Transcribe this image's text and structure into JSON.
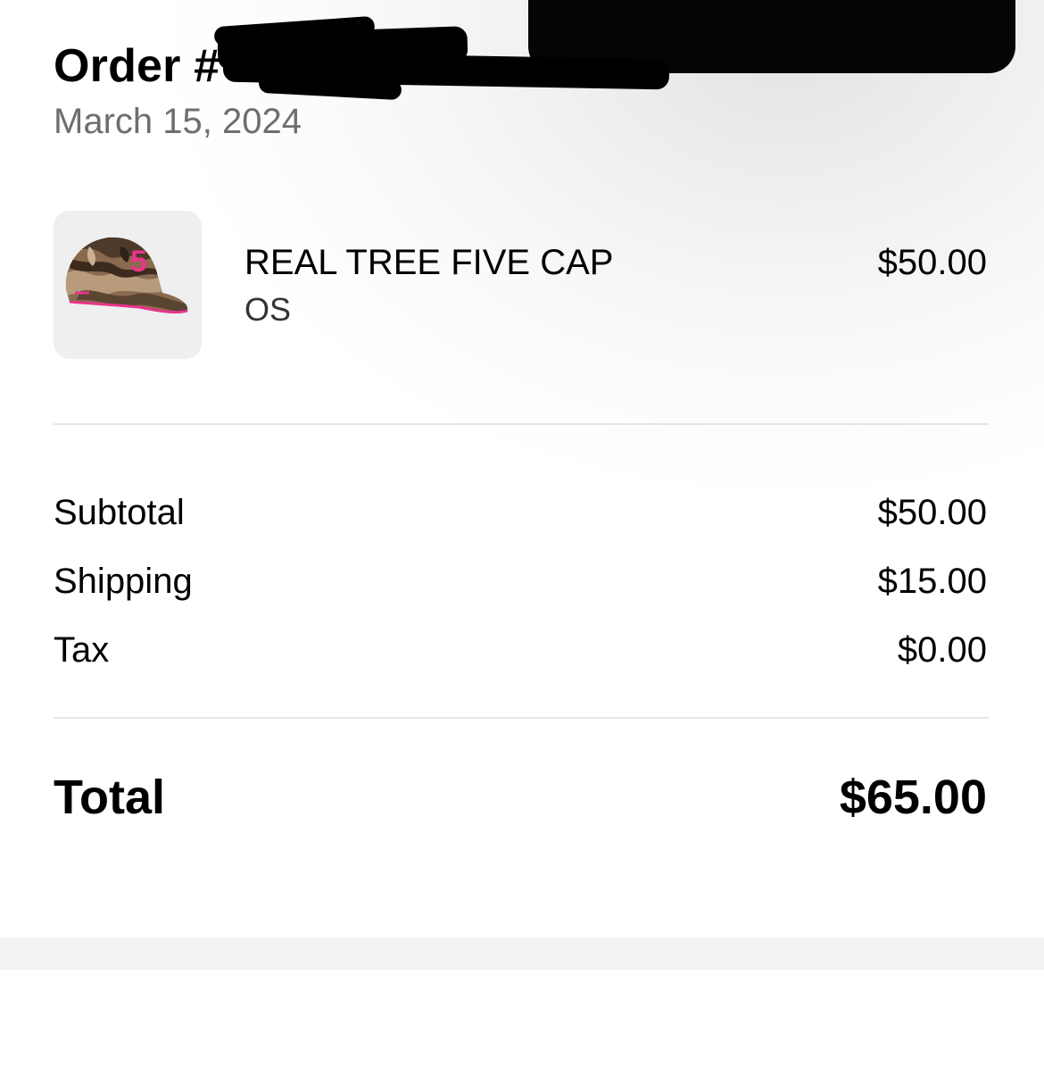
{
  "order": {
    "title": "Order #",
    "date": "March 15, 2024"
  },
  "item": {
    "name": "REAL TREE FIVE CAP",
    "variant": "OS",
    "price": "$50.00",
    "image": "camo-cap-thumbnail",
    "accent_color": "#e8348a"
  },
  "summary": {
    "rows": [
      {
        "label": "Subtotal",
        "value": "$50.00"
      },
      {
        "label": "Shipping",
        "value": "$15.00"
      },
      {
        "label": "Tax",
        "value": "$0.00"
      }
    ],
    "total_label": "Total",
    "total_value": "$65.00"
  }
}
